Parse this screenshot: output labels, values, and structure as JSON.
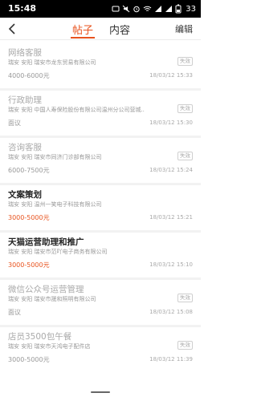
{
  "status_bar": {
    "time": "15:48",
    "battery": "33"
  },
  "nav": {
    "tab_posts": "帖子",
    "tab_content": "内容",
    "edit_label": "编辑"
  },
  "jobs": [
    {
      "title": "网络客服",
      "company": "瑞安 安阳 瑞安市龙东贸易有限公司",
      "salary": "4000-6000元",
      "date": "18/03/12 15:33",
      "badge": "失效"
    },
    {
      "title": "行政助理",
      "company": "瑞安 安阳 中国人寿保险股份有限公司温州分公司营城...",
      "salary": "面议",
      "date": "18/03/12 15:30",
      "badge": "失效"
    },
    {
      "title": "咨询客服",
      "company": "瑞安 安阳 瑞安市同济门诊部有限公司",
      "salary": "6000-7500元",
      "date": "18/03/12 15:24",
      "badge": "失效"
    },
    {
      "title": "文案策划",
      "company": "瑞安 安阳 温州一笑电子科技有限公司",
      "salary": "3000-5000元",
      "date": "18/03/12 15:21",
      "badge": ""
    },
    {
      "title": "天猫运营助理和推广",
      "company": "瑞安 安阳 瑞安市范吖电子商务有限公司",
      "salary": "3000-5000元",
      "date": "18/03/12 15:10",
      "badge": ""
    },
    {
      "title": "微信公众号运营管理",
      "company": "瑞安 安阳 瑞安市晟和照明有限公司",
      "salary": "面议",
      "date": "18/03/12 15:08",
      "badge": "失效"
    },
    {
      "title": "店员3500包午餐",
      "company": "瑞安 安阳 瑞安市天鸿电子配件店",
      "salary": "3000-5000元",
      "date": "18/03/12 11:39",
      "badge": "失效"
    }
  ],
  "colors": {
    "accent": "#e8531e",
    "expired_text": "#aaaaaa"
  },
  "icons": {
    "back": "chevron-left-icon"
  }
}
